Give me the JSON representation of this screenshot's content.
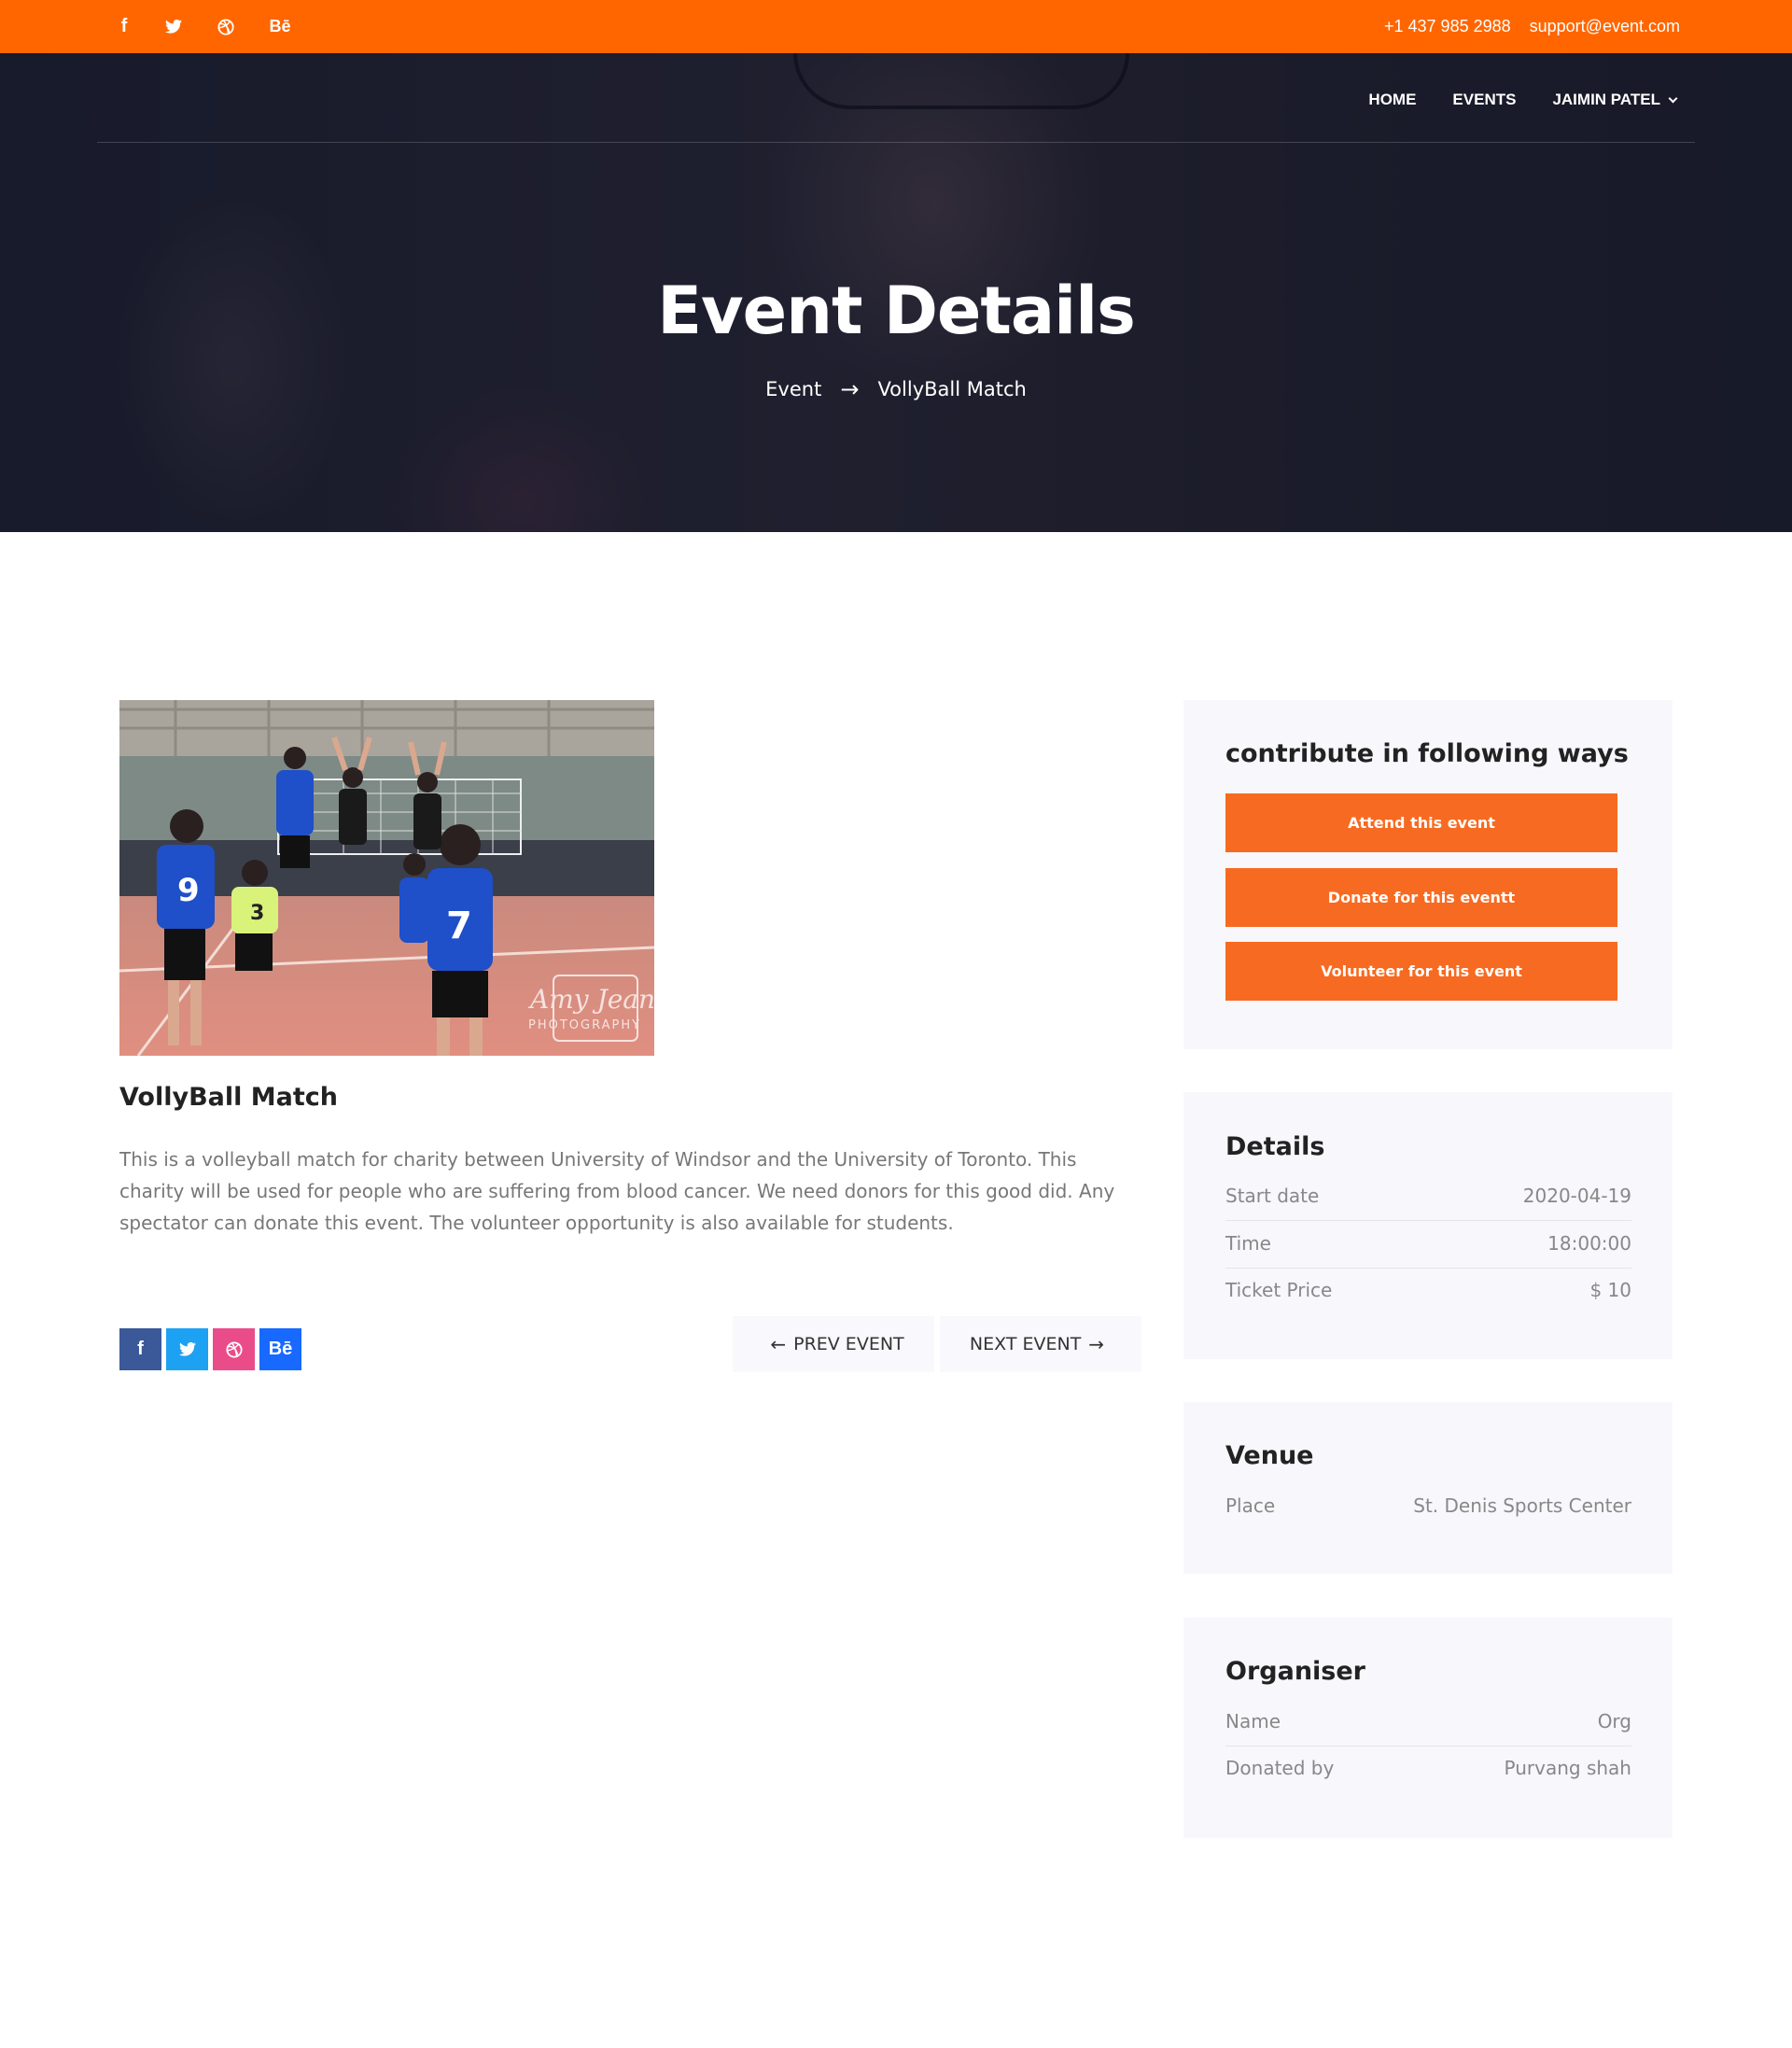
{
  "topbar": {
    "social": [
      {
        "icon": "facebook-icon",
        "glyph": "f"
      },
      {
        "icon": "twitter-icon",
        "glyph": "🐦"
      },
      {
        "icon": "dribbble-icon",
        "glyph": "⊛"
      },
      {
        "icon": "behance-icon",
        "glyph": "Bē"
      }
    ],
    "phone": "+1 437 985 2988",
    "email": "support@event.com",
    "bg_color": "#ff6600"
  },
  "nav": {
    "items": [
      "HOME",
      "EVENTS",
      "JAIMIN PATEL"
    ]
  },
  "hero": {
    "title": "Event Details",
    "breadcrumb": {
      "parent": "Event",
      "separator": "→",
      "current": "VollyBall Match"
    }
  },
  "event": {
    "title": "VollyBall Match",
    "description": "This is a volleyball match for charity between University of Windsor and the University of Toronto. This charity will be used for people who are suffering from blood cancer. We need donors for this good did. Any spectator can donate this event. The volunteer opportunity is also available for students.",
    "image_watermark": "Amy Jean PHOTOGRAPHY"
  },
  "share": {
    "facebook": "f",
    "twitter": "🐦",
    "dribbble": "⊛",
    "behance": "Bē"
  },
  "pager": {
    "prev": "PREV EVENT",
    "next": "NEXT EVENT"
  },
  "contribute": {
    "title": "contribute in following ways",
    "attend": "Attend this event",
    "donate": "Donate for this eventt",
    "volunteer": "Volunteer for this event",
    "accent": "#f76a21"
  },
  "details": {
    "title": "Details",
    "rows": [
      {
        "label": "Start date",
        "value": "2020-04-19"
      },
      {
        "label": "Time",
        "value": "18:00:00"
      },
      {
        "label": "Ticket Price",
        "value": "$ 10"
      }
    ]
  },
  "venue": {
    "title": "Venue",
    "rows": [
      {
        "label": "Place",
        "value": "St. Denis Sports Center"
      }
    ]
  },
  "organiser": {
    "title": "Organiser",
    "rows": [
      {
        "label": "Name",
        "value": "Org"
      },
      {
        "label": "Donated by",
        "value": "Purvang shah"
      }
    ]
  }
}
